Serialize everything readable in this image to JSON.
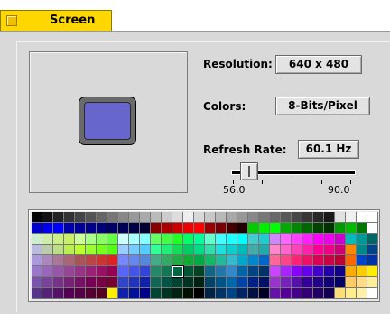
{
  "tab": {
    "label": "Screen"
  },
  "settings": {
    "resolution": {
      "label": "Resolution:",
      "value": "640 x 480"
    },
    "colors": {
      "label": "Colors:",
      "value": "8-Bits/Pixel"
    },
    "refresh_rate": {
      "label": "Refresh Rate:",
      "value": "60.1 Hz",
      "min_label": "56.0",
      "max_label": "90.0",
      "level_fraction": 0.12
    }
  },
  "colors": {
    "tab": "#ffd700",
    "panel": "#d9d9d9",
    "monitor_screen": "#6666cc"
  },
  "palette": {
    "selected_cell": [
      13,
      5
    ],
    "rows": [
      [
        "#000000",
        "#111111",
        "#222222",
        "#333333",
        "#444444",
        "#555555",
        "#666666",
        "#777777",
        "#888888",
        "#999999",
        "#aaaaaa",
        "#bbbbbb",
        "#cccccc",
        "#dddddd",
        "#eeeeee",
        "#d8d8d8",
        "#c8c8c8",
        "#b8b8b8",
        "#a8a8a8",
        "#989898",
        "#888888",
        "#787878",
        "#686868",
        "#585858",
        "#484848",
        "#383838",
        "#282828",
        "#1a1a1a",
        "#e0e0e0",
        "#f0f0f0",
        "#ffffff",
        "#ffffff"
      ],
      [
        "#0000cc",
        "#0000ee",
        "#0000ff",
        "#0000aa",
        "#000099",
        "#000088",
        "#000077",
        "#000066",
        "#000055",
        "#000044",
        "#000033",
        "#880000",
        "#aa0000",
        "#cc0000",
        "#ee0000",
        "#ff0000",
        "#990000",
        "#770000",
        "#440000",
        "#220000",
        "#00cc00",
        "#00ee00",
        "#00ff00",
        "#00aa00",
        "#008800",
        "#006600",
        "#004400",
        "#003300",
        "#009900",
        "#00bb00",
        "#007700",
        "#ffffff"
      ],
      [
        "#cceecc",
        "#cceeaa",
        "#ccee88",
        "#ccee66",
        "#ccff99",
        "#aaff88",
        "#88ff66",
        "#66ff44",
        "#ccffff",
        "#aaffff",
        "#88ffff",
        "#66ff66",
        "#44ff44",
        "#22ff22",
        "#00ff66",
        "#00ff99",
        "#66ffcc",
        "#44ffff",
        "#22ffff",
        "#00ffff",
        "#44cccc",
        "#22cccc",
        "#cc88ff",
        "#ff66ff",
        "#ff44ff",
        "#ff22ff",
        "#ff00ff",
        "#ee00ee",
        "#cc00cc",
        "#00bbbb",
        "#009999",
        "#006666"
      ],
      [
        "#bbbbdd",
        "#bbccaa",
        "#bbdd88",
        "#bbee55",
        "#bbff33",
        "#99ff33",
        "#77ff22",
        "#55ff11",
        "#99ccff",
        "#77ccff",
        "#55ccff",
        "#33ff99",
        "#22ee77",
        "#11dd55",
        "#00cc66",
        "#00dd88",
        "#33ddaa",
        "#22dddd",
        "#11cccc",
        "#00bbbb",
        "#44aaaa",
        "#22aaaa",
        "#ff88cc",
        "#ff66cc",
        "#ff44bb",
        "#ff22aa",
        "#ff0099",
        "#ee0088",
        "#cc0077",
        "#ff8800",
        "#008888",
        "#004488"
      ],
      [
        "#aa99dd",
        "#aa88bb",
        "#aa7799",
        "#aa6677",
        "#aa5555",
        "#bb4444",
        "#cc3333",
        "#dd2222",
        "#7788ff",
        "#6688ee",
        "#5588dd",
        "#44aa88",
        "#33aa66",
        "#22aa44",
        "#11aa33",
        "#00aa44",
        "#11bb66",
        "#22bb99",
        "#33bbcc",
        "#00aacc",
        "#0088cc",
        "#0066cc",
        "#ff6699",
        "#ff4488",
        "#ff2277",
        "#ee1166",
        "#dd0055",
        "#cc0044",
        "#bb0033",
        "#ff6600",
        "#0044cc",
        "#0033aa"
      ],
      [
        "#9977cc",
        "#9966bb",
        "#9955aa",
        "#994499",
        "#993388",
        "#992277",
        "#991166",
        "#990055",
        "#5566ff",
        "#4455ee",
        "#3344dd",
        "#228866",
        "#117755",
        "#006644",
        "#005533",
        "#004422",
        "#116688",
        "#2277aa",
        "#3388cc",
        "#0066aa",
        "#004488",
        "#003366",
        "#cc44ff",
        "#aa22ff",
        "#8800ff",
        "#6600ee",
        "#4400cc",
        "#2200aa",
        "#110088",
        "#ffaa00",
        "#ffcc00",
        "#ffee00"
      ],
      [
        "#7755aa",
        "#774499",
        "#773388",
        "#772277",
        "#771166",
        "#770055",
        "#770044",
        "#770033",
        "#3344cc",
        "#2233bb",
        "#1122aa",
        "#116655",
        "#005544",
        "#004433",
        "#003322",
        "#002211",
        "#004466",
        "#005588",
        "#0066aa",
        "#0044aa",
        "#002288",
        "#001166",
        "#9933cc",
        "#7722bb",
        "#5511aa",
        "#330099",
        "#220088",
        "#110077",
        "#000066",
        "#ffcc66",
        "#ffdd88",
        "#ffee99"
      ],
      [
        "#553388",
        "#552277",
        "#551166",
        "#550055",
        "#550044",
        "#550033",
        "#550022",
        "#ffee00",
        "#1122aa",
        "#001199",
        "#000088",
        "#004433",
        "#003322",
        "#002211",
        "#001100",
        "#000000",
        "#002244",
        "#003366",
        "#004488",
        "#002266",
        "#001144",
        "#000022",
        "#6611aa",
        "#550099",
        "#440088",
        "#330077",
        "#220066",
        "#110055",
        "#ffdd77",
        "#ffee88",
        "#fff0aa",
        "#ffffff"
      ]
    ]
  }
}
